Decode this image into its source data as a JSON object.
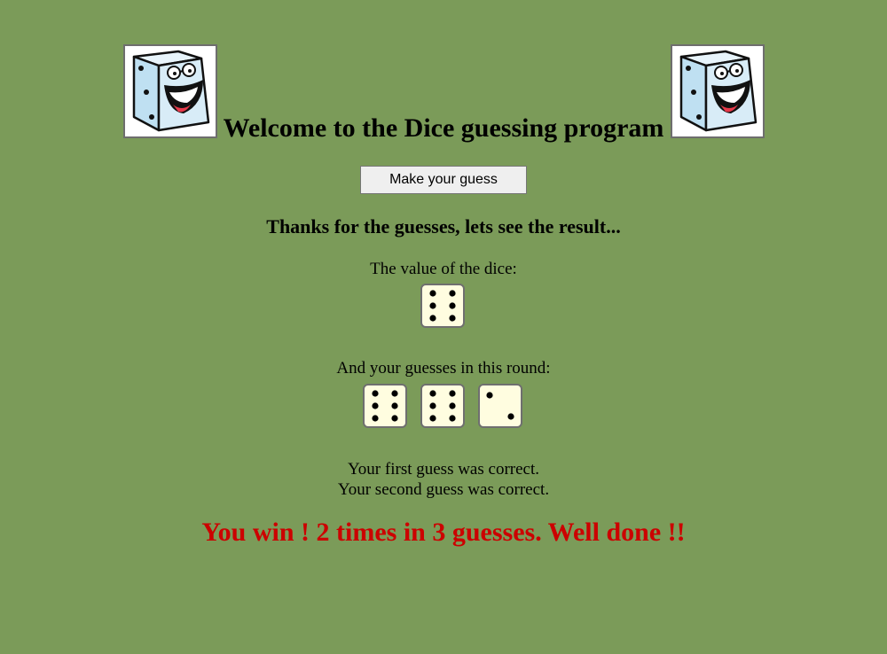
{
  "header": {
    "title": "Welcome to the Dice guessing program",
    "mascot_icon": "smiling-dice-mascot-icon"
  },
  "action": {
    "guess_button": "Make your guess"
  },
  "result_section": {
    "thanks_text": "Thanks for the guesses, lets see the result...",
    "dice_value_label": "The value of the dice:",
    "dice_value": 6,
    "guesses_label": "And your guesses in this round:",
    "guesses": [
      6,
      6,
      2
    ],
    "messages": [
      "Your first guess was correct.",
      "Your second guess was correct."
    ],
    "win_text": "You win ! 2 times in 3 guesses. Well done !!"
  },
  "colors": {
    "background": "#7b9b59",
    "win_text": "#cc0000",
    "die_face": "#fffde0"
  }
}
